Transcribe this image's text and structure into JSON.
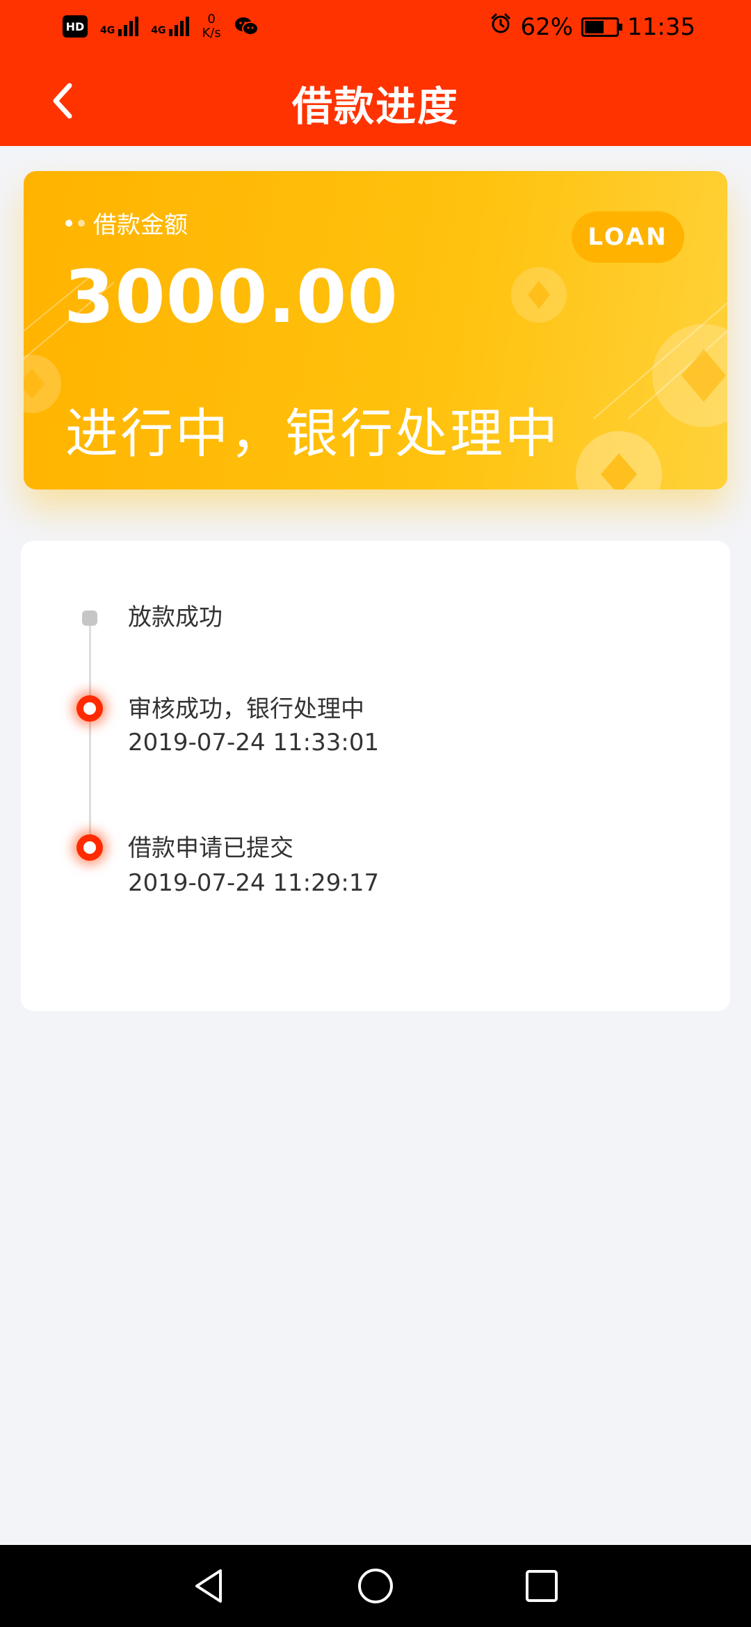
{
  "status_bar": {
    "hd_label": "HD",
    "network_1": "4G",
    "network_2": "4G",
    "net_speed_value": "0",
    "net_speed_unit": "K/s",
    "battery_percent": "62%",
    "battery_level": 0.62,
    "time": "11:35"
  },
  "header": {
    "title": "借款进度"
  },
  "loan_card": {
    "label": "借款金额",
    "amount": "3000.00",
    "status": "进行中，银行处理中",
    "badge": "LOAN",
    "colors": {
      "gradient_start": "#ffb300",
      "gradient_end": "#ffd23a"
    }
  },
  "timeline": {
    "items": [
      {
        "title": "放款成功",
        "time": ""
      },
      {
        "title": "审核成功，银行处理中",
        "time": "2019-07-24 11:33:01"
      },
      {
        "title": "借款申请已提交",
        "time": "2019-07-24 11:29:17"
      }
    ]
  },
  "theme": {
    "header_color": "#ff3300",
    "accent_red": "#ff2a00",
    "page_bg": "#f3f4f8"
  }
}
